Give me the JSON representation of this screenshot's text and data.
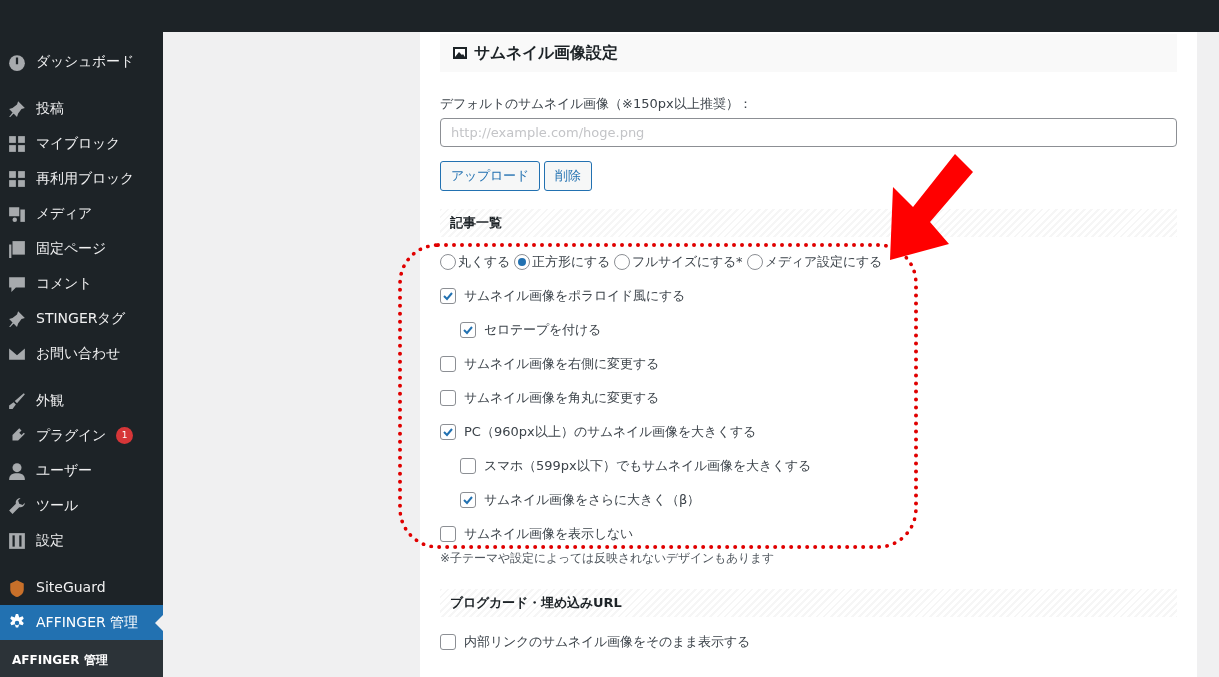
{
  "sidebar": {
    "groups": [
      [
        {
          "label": "ダッシュボード",
          "selected": false
        }
      ],
      [
        {
          "label": "投稿",
          "selected": false
        },
        {
          "label": "マイブロック",
          "selected": false
        },
        {
          "label": "再利用ブロック",
          "selected": false
        },
        {
          "label": "メディア",
          "selected": false
        },
        {
          "label": "固定ページ",
          "selected": false
        },
        {
          "label": "コメント",
          "selected": false
        },
        {
          "label": "STINGERタグ",
          "selected": false
        },
        {
          "label": "お問い合わせ",
          "selected": false
        }
      ],
      [
        {
          "label": "外観",
          "selected": false
        },
        {
          "label": "プラグイン",
          "selected": false,
          "badge": "1"
        },
        {
          "label": "ユーザー",
          "selected": false
        },
        {
          "label": "ツール",
          "selected": false
        },
        {
          "label": "設定",
          "selected": false
        }
      ],
      [
        {
          "label": "SiteGuard",
          "selected": false
        },
        {
          "label": "AFFINGER 管理",
          "selected": true
        }
      ]
    ],
    "submenu": [
      {
        "label": "AFFINGER 管理",
        "selected": true
      }
    ]
  },
  "panel": {
    "title": "サムネイル画像設定",
    "field_label": "デフォルトのサムネイル画像（※150px以上推奨）：",
    "field": {
      "placeholder": "http://example.com/hoge.png"
    },
    "buttons": [
      "アップロード",
      "削除"
    ],
    "sections": [
      {
        "heading": "記事一覧",
        "radios": [
          {
            "label": "丸くする",
            "selected": false
          },
          {
            "label": "正方形にする",
            "selected": true
          },
          {
            "label": "フルサイズにする*",
            "selected": false
          },
          {
            "label": "メディア設定にする",
            "selected": false
          }
        ],
        "options": [
          {
            "label": "サムネイル画像をポラロイド風にする",
            "checked": true,
            "children": [
              {
                "label": "セロテープを付ける",
                "checked": true
              }
            ]
          },
          {
            "label": "サムネイル画像を右側に変更する",
            "checked": false
          },
          {
            "label": "サムネイル画像を角丸に変更する",
            "checked": false
          },
          {
            "label": "PC（960px以上）のサムネイル画像を大きくする",
            "checked": true,
            "children": [
              {
                "label": "スマホ（599px以下）でもサムネイル画像を大きくする",
                "checked": false
              },
              {
                "label": "サムネイル画像をさらに大きく（β）",
                "checked": true
              }
            ]
          },
          {
            "label": "サムネイル画像を表示しない",
            "checked": false
          }
        ],
        "note": "※子テーマや設定によっては反映されないデザインもあります"
      },
      {
        "heading": "ブログカード・埋め込みURL",
        "options": [
          {
            "label": "内部リンクのサムネイル画像をそのまま表示する",
            "checked": false
          }
        ]
      }
    ]
  }
}
